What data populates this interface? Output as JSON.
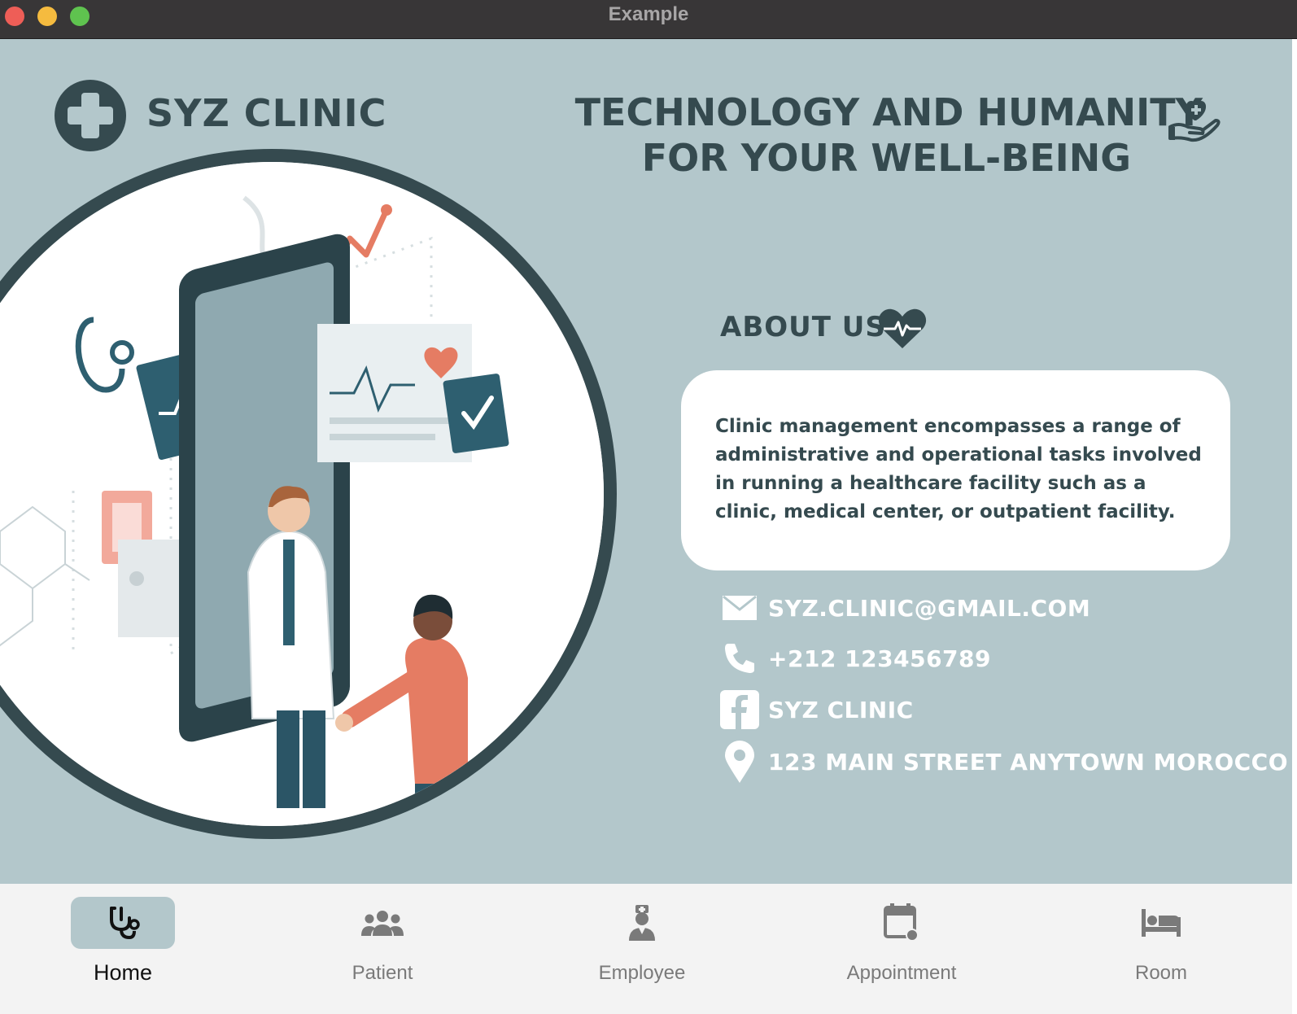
{
  "window": {
    "title": "Example"
  },
  "header": {
    "brand": "SYZ CLINIC",
    "tagline_line1": "TECHNOLOGY AND HUMANITY",
    "tagline_line2": "FOR YOUR WELL-BEING"
  },
  "about": {
    "title": "ABOUT US",
    "body": "Clinic management encompasses a range of administrative and operational tasks involved in running a healthcare facility such as a clinic, medical center, or outpatient facility."
  },
  "contacts": {
    "email": "SYZ.CLINIC@GMAIL.COM",
    "phone": "+212 123456789",
    "facebook": "SYZ CLINIC",
    "address": "123 MAIN STREET ANYTOWN MOROCCO"
  },
  "nav": {
    "active": "Home",
    "items": [
      {
        "label": "Home",
        "icon": "stethoscope-icon"
      },
      {
        "label": "Patient",
        "icon": "people-icon"
      },
      {
        "label": "Employee",
        "icon": "nurse-icon"
      },
      {
        "label": "Appointment",
        "icon": "calendar-icon"
      },
      {
        "label": "Room",
        "icon": "bed-icon"
      }
    ]
  },
  "colors": {
    "background": "#b3c7cb",
    "primary_dark": "#354a4f",
    "accent": "#e57c63",
    "nav_bg": "#f3f3f3"
  }
}
